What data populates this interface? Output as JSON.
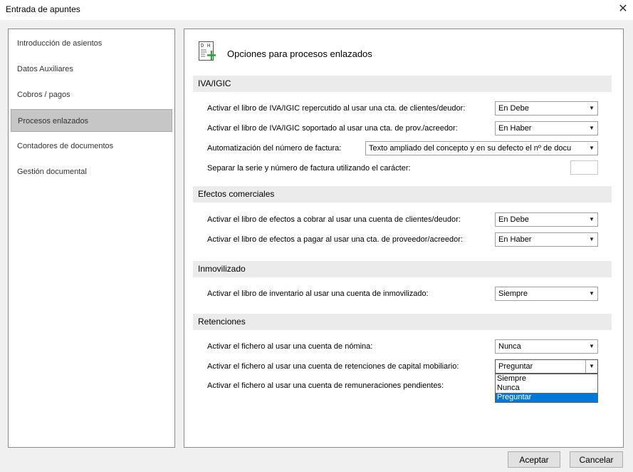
{
  "window": {
    "title": "Entrada de apuntes"
  },
  "nav": {
    "items": [
      {
        "label": "Introducción de asientos"
      },
      {
        "label": "Datos Auxiliares"
      },
      {
        "label": "Cobros / pagos"
      },
      {
        "label": "Procesos enlazados",
        "selected": true
      },
      {
        "label": "Contadores de documentos"
      },
      {
        "label": "Gestión documental"
      }
    ]
  },
  "panel": {
    "icon": "options-document-icon",
    "icon_letters": [
      "D",
      "H"
    ],
    "title": "Opciones para procesos enlazados"
  },
  "sections": {
    "iva": {
      "title": "IVA/IGIC",
      "rows": [
        {
          "label": "Activar el libro de IVA/IGIC repercutido al usar una cta. de clientes/deudor:",
          "value": "En Debe"
        },
        {
          "label": "Activar el libro de IVA/IGIC soportado al usar una cta. de prov./acreedor:",
          "value": "En Haber"
        },
        {
          "label": "Automatización del número de factura:",
          "value": "Texto ampliado del concepto y en su defecto el nº de docu"
        },
        {
          "label": "Separar la serie y número de factura utilizando el carácter:",
          "value": ""
        }
      ]
    },
    "efectos": {
      "title": "Efectos comerciales",
      "rows": [
        {
          "label": "Activar el libro de efectos a cobrar al usar una cuenta de clientes/deudor:",
          "value": "En Debe"
        },
        {
          "label": "Activar el libro de efectos a pagar al usar una cta. de proveedor/acreedor:",
          "value": "En Haber"
        }
      ]
    },
    "inmovilizado": {
      "title": "Inmovilizado",
      "rows": [
        {
          "label": "Activar el libro de inventario al usar una cuenta de inmovilizado:",
          "value": "Siempre"
        }
      ]
    },
    "retenciones": {
      "title": "Retenciones",
      "rows": [
        {
          "label": "Activar el fichero al usar una cuenta de nómina:",
          "value": "Nunca"
        },
        {
          "label": "Activar el fichero al usar una cuenta de retenciones de capital mobiliario:",
          "value": "Preguntar"
        },
        {
          "label": "Activar el fichero al usar una cuenta de remuneraciones pendientes:",
          "value": ""
        }
      ],
      "dropdown_options": [
        "Siempre",
        "Nunca",
        "Preguntar"
      ],
      "dropdown_selected": "Preguntar"
    }
  },
  "buttons": {
    "accept": "Aceptar",
    "cancel": "Cancelar"
  },
  "colors": {
    "selected_option": "#0078d7",
    "nav_selected": "#c6c6c6",
    "section_bg": "#ebebeb",
    "icon_accent": "#2e9e3e"
  }
}
